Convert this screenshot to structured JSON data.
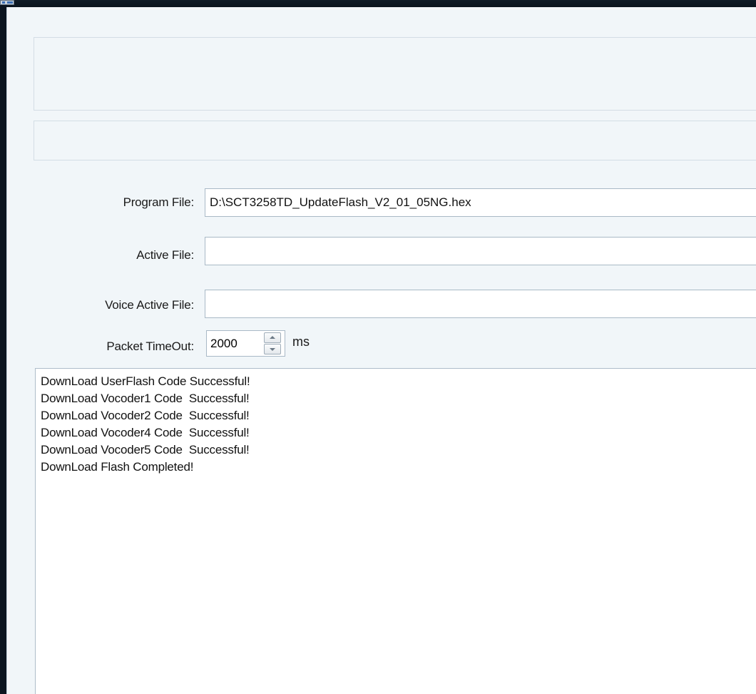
{
  "window": {
    "icon": "app-window-icon"
  },
  "form": {
    "program_file": {
      "label": "Program File:",
      "value": "D:\\SCT3258TD_UpdateFlash_V2_01_05NG.hex"
    },
    "active_file": {
      "label": "Active File:",
      "value": ""
    },
    "voice_active_file": {
      "label": "Voice Active File:",
      "value": ""
    },
    "packet_timeout": {
      "label": "Packet TimeOut:",
      "value": "2000",
      "unit": "ms"
    }
  },
  "log": {
    "lines": [
      "DownLoad UserFlash Code Successful!",
      "DownLoad Vocoder1 Code  Successful!",
      "DownLoad Vocoder2 Code  Successful!",
      "DownLoad Vocoder4 Code  Successful!",
      "DownLoad Vocoder5 Code  Successful!",
      "DownLoad Flash Completed!"
    ]
  }
}
